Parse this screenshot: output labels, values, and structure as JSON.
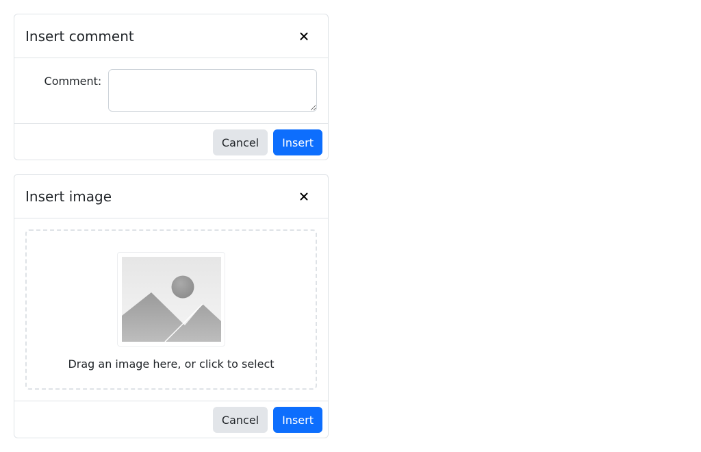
{
  "comment_dialog": {
    "title": "Insert comment",
    "close_icon": "close-icon",
    "comment_label": "Comment:",
    "comment_value": "",
    "cancel_label": "Cancel",
    "insert_label": "Insert"
  },
  "image_dialog": {
    "title": "Insert image",
    "close_icon": "close-icon",
    "placeholder_icon": "image-placeholder-icon",
    "drop_text": "Drag an image here, or click to select",
    "cancel_label": "Cancel",
    "insert_label": "Insert"
  },
  "colors": {
    "primary": "#0d6efd",
    "secondary_bg": "#e2e5e9",
    "border": "#dee2e6"
  }
}
